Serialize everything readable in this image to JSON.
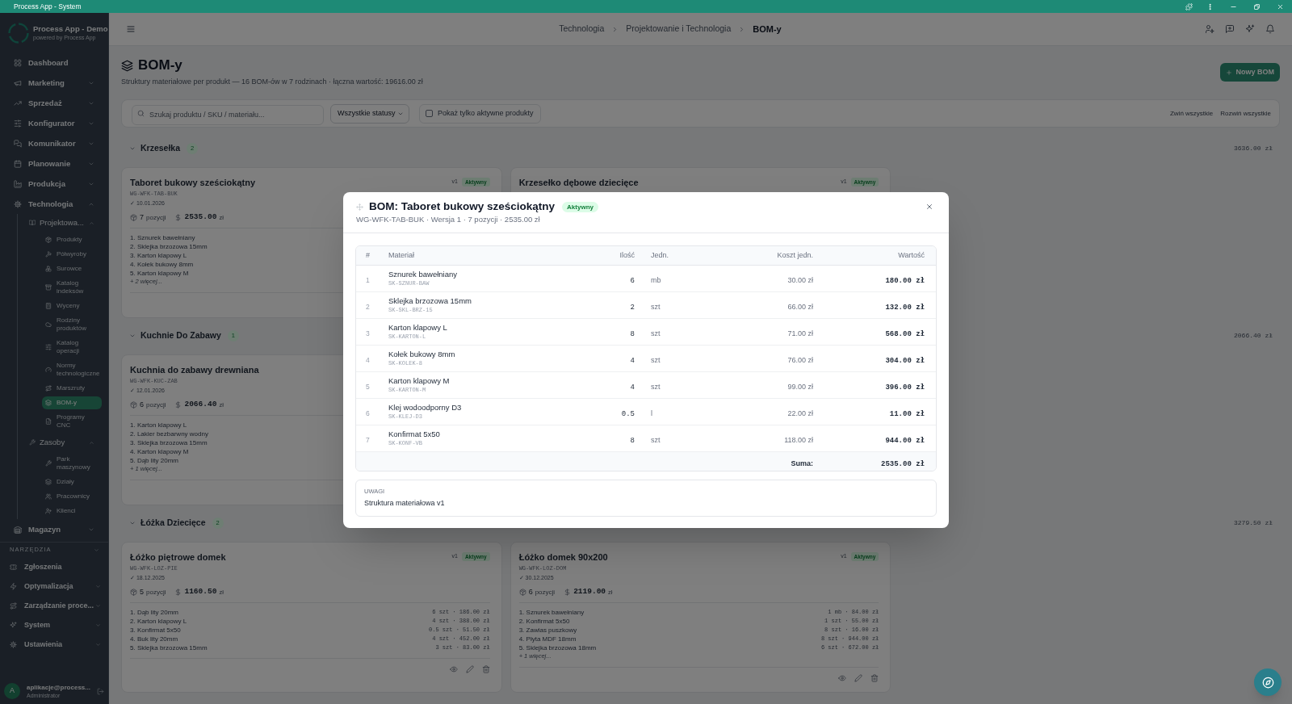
{
  "title_bar": {
    "title": "Process App - System"
  },
  "sidebar": {
    "brand": {
      "name": "Process App - Demo",
      "tagline": "powered by Process App"
    },
    "nav": [
      {
        "label": "Dashboard",
        "selected": false
      },
      {
        "label": "Marketing",
        "selected": false,
        "expanded": false
      },
      {
        "label": "Sprzedaż",
        "selected": false,
        "expanded": false
      },
      {
        "label": "Konfigurator",
        "selected": false,
        "expanded": false
      },
      {
        "label": "Komunikator",
        "selected": false,
        "expanded": false
      },
      {
        "label": "Planowanie",
        "selected": false,
        "expanded": false
      },
      {
        "label": "Produkcja",
        "selected": false,
        "expanded": false
      },
      {
        "label": "Technologia",
        "selected": false,
        "expanded": true,
        "children": [
          {
            "label": "Projektowa...",
            "selected": false,
            "expanded": true,
            "children": [
              {
                "label": "Produkty",
                "selected": false
              },
              {
                "label": "Półwyroby",
                "selected": false
              },
              {
                "label": "Surowce",
                "selected": false
              },
              {
                "label": "Katalog indeksów",
                "selected": false
              },
              {
                "label": "Wyceny",
                "selected": false
              },
              {
                "label": "Rodziny produktów",
                "selected": false
              },
              {
                "label": "Katalog operacji",
                "selected": false
              },
              {
                "label": "Normy technologiczne",
                "selected": false
              },
              {
                "label": "Marszruty",
                "selected": false
              },
              {
                "label": "BOM-y",
                "selected": true
              },
              {
                "label": "Programy CNC",
                "selected": false
              }
            ]
          },
          {
            "label": "Zasoby",
            "selected": false,
            "expanded": true,
            "children": [
              {
                "label": "Park maszynowy",
                "selected": false
              },
              {
                "label": "Działy",
                "selected": false
              },
              {
                "label": "Pracownicy",
                "selected": false
              },
              {
                "label": "Klienci",
                "selected": false
              }
            ]
          }
        ]
      },
      {
        "label": "Magazyn",
        "selected": false,
        "expanded": false
      }
    ],
    "tools": {
      "heading": "NARZĘDZIA",
      "items": [
        {
          "label": "Zgłoszenia",
          "selected": false
        },
        {
          "label": "Optymalizacja",
          "selected": false,
          "expanded": false
        },
        {
          "label": "Zarządzanie proce...",
          "selected": false,
          "expanded": false
        },
        {
          "label": "System",
          "selected": false,
          "expanded": false
        },
        {
          "label": "Ustawienia",
          "selected": false,
          "expanded": false
        }
      ]
    },
    "user": {
      "initial": "A",
      "name": "aplikacje@process...",
      "role": "Administrator"
    }
  },
  "header": {
    "breadcrumb": [
      {
        "label": "Technologia",
        "current": false
      },
      {
        "label": "Projektowanie i Technologia",
        "current": false
      },
      {
        "label": "BOM-y",
        "current": true
      }
    ]
  },
  "page": {
    "title": "BOM-y",
    "subtitle": "Struktury materiałowe per produkt — 16 BOM-ów w 7 rodzinach · łączna wartość: 19616.00 zł",
    "new_button": "Nowy BOM"
  },
  "filters": {
    "search": {
      "placeholder": "Szukaj produktu / SKU / materiału..."
    },
    "status": {
      "value": "Wszystkie statusy"
    },
    "active_only": {
      "label": "Pokaż tylko aktywne produkty",
      "checked": false
    },
    "collapse_all": "Zwiń wszystkie",
    "expand_all": "Rozwiń wszystkie"
  },
  "groups": [
    {
      "name": "Krzesełka",
      "count": "2",
      "total": "3636.00 zł",
      "expanded": true,
      "boms": [
        {
          "name": "Taboret bukowy sześciokątny",
          "version": "v1",
          "status": "Aktywny",
          "sku": "WG-WFK-TAB-BUK",
          "date": "✓ 10.01.2026",
          "positions": "7",
          "positions_label": "pozycji",
          "value": "2535.00",
          "currency": "zł",
          "lines": [
            {
              "text": "1. Sznurek bawełniany"
            },
            {
              "text": "2. Sklejka brzozowa 15mm"
            },
            {
              "text": "3. Karton klapowy L"
            },
            {
              "text": "4. Kołek bukowy 8mm"
            },
            {
              "text": "5. Karton klapowy M"
            }
          ],
          "more": "+ 2 więcej..."
        },
        {
          "name": "Krzesełko dębowe dziecięce",
          "version": "v1",
          "status": "Aktywny"
        }
      ]
    },
    {
      "name": "Kuchnie Do Zabawy",
      "count": "1",
      "total": "2066.40 zł",
      "expanded": true,
      "boms": [
        {
          "name": "Kuchnia do zabawy drewniana",
          "sku": "WG-WFK-KUC-ZAB",
          "date": "✓ 12.01.2026",
          "positions": "6",
          "positions_label": "pozycji",
          "value": "2066.40",
          "currency": "zł",
          "lines": [
            {
              "text": "1. Karton klapowy L"
            },
            {
              "text": "2. Lakier bezbarwny wodny"
            },
            {
              "text": "3. Sklejka brzozowa 15mm"
            },
            {
              "text": "4. Karton klapowy M"
            },
            {
              "text": "5. Dąb lity 20mm"
            }
          ],
          "more": "+ 1 więcej..."
        }
      ]
    },
    {
      "name": "Łóżka Dziecięce",
      "count": "2",
      "total": "3279.50 zł",
      "expanded": true,
      "boms": [
        {
          "name": "Łóżko piętrowe domek",
          "version": "v1",
          "status": "Aktywny",
          "sku": "WG-WFK-LOZ-PIE",
          "date": "✓ 18.12.2025",
          "positions": "5",
          "positions_label": "pozycji",
          "value": "1160.50",
          "currency": "zł",
          "lines": [
            {
              "text": "1. Dąb lity 20mm",
              "detail": "6 szt · 186.00 zł"
            },
            {
              "text": "2. Karton klapowy L",
              "detail": "4 szt · 388.00 zł"
            },
            {
              "text": "3. Konfirmat 5x50",
              "detail": "0.5 szt · 51.50 zł"
            },
            {
              "text": "4. Buk lity 20mm",
              "detail": "4 szt · 452.00 zł"
            },
            {
              "text": "5. Sklejka brzozowa 15mm",
              "detail": "3 szt · 83.00 zł"
            }
          ]
        },
        {
          "name": "Łóżko domek 90x200",
          "version": "v1",
          "status": "Aktywny",
          "sku": "WG-WFK-LOZ-DOM",
          "date": "✓ 30.12.2025",
          "positions": "6",
          "positions_label": "pozycji",
          "value": "2119.00",
          "currency": "zł",
          "lines": [
            {
              "text": "1. Sznurek bawełniany",
              "detail": "1 mb · 84.00 zł"
            },
            {
              "text": "2. Konfirmat 5x50",
              "detail": "1 szt · 55.00 zł"
            },
            {
              "text": "3. Zawias puszkowy",
              "detail": "8 szt · 16.00 zł"
            },
            {
              "text": "4. Płyta MDF 18mm",
              "detail": "8 szt · 944.00 zł"
            },
            {
              "text": "5. Sklejka brzozowa 18mm",
              "detail": "6 szt · 672.00 zł"
            }
          ],
          "more": "+ 1 więcej..."
        }
      ]
    }
  ],
  "modal": {
    "title": "BOM: Taboret bukowy sześciokątny",
    "status": "Aktywny",
    "subtitle": "WG-WFK-TAB-BUK · Wersja 1 · 7 pozycji · 2535.00 zł",
    "table": {
      "columns": [
        "#",
        "Materiał",
        "Ilość",
        "Jedn.",
        "Koszt jedn.",
        "Wartość"
      ],
      "rows": [
        {
          "no": "1",
          "material": "Sznurek bawełniany",
          "sku": "SK-SZNUR-BAW",
          "qty": "6",
          "unit": "mb",
          "unit_cost": "30.00 zł",
          "value": "180.00 zł"
        },
        {
          "no": "2",
          "material": "Sklejka brzozowa 15mm",
          "sku": "SK-SKL-BRZ-15",
          "qty": "2",
          "unit": "szt",
          "unit_cost": "66.00 zł",
          "value": "132.00 zł"
        },
        {
          "no": "3",
          "material": "Karton klapowy L",
          "sku": "SK-KARTON-L",
          "qty": "8",
          "unit": "szt",
          "unit_cost": "71.00 zł",
          "value": "568.00 zł"
        },
        {
          "no": "4",
          "material": "Kołek bukowy 8mm",
          "sku": "SK-KOLEK-8",
          "qty": "4",
          "unit": "szt",
          "unit_cost": "76.00 zł",
          "value": "304.00 zł"
        },
        {
          "no": "5",
          "material": "Karton klapowy M",
          "sku": "SK-KARTON-M",
          "qty": "4",
          "unit": "szt",
          "unit_cost": "99.00 zł",
          "value": "396.00 zł"
        },
        {
          "no": "6",
          "material": "Klej wodoodporny D3",
          "sku": "SK-KLEJ-D3",
          "qty": "0.5",
          "unit": "l",
          "unit_cost": "22.00 zł",
          "value": "11.00 zł"
        },
        {
          "no": "7",
          "material": "Konfirmat 5x50",
          "sku": "SK-KONF-VB",
          "qty": "8",
          "unit": "szt",
          "unit_cost": "118.00 zł",
          "value": "944.00 zł"
        }
      ],
      "sum_label": "Suma:",
      "sum_value": "2535.00 zł"
    },
    "notes": {
      "label": "UWAGI",
      "text": "Struktura materiałowa v1"
    }
  }
}
